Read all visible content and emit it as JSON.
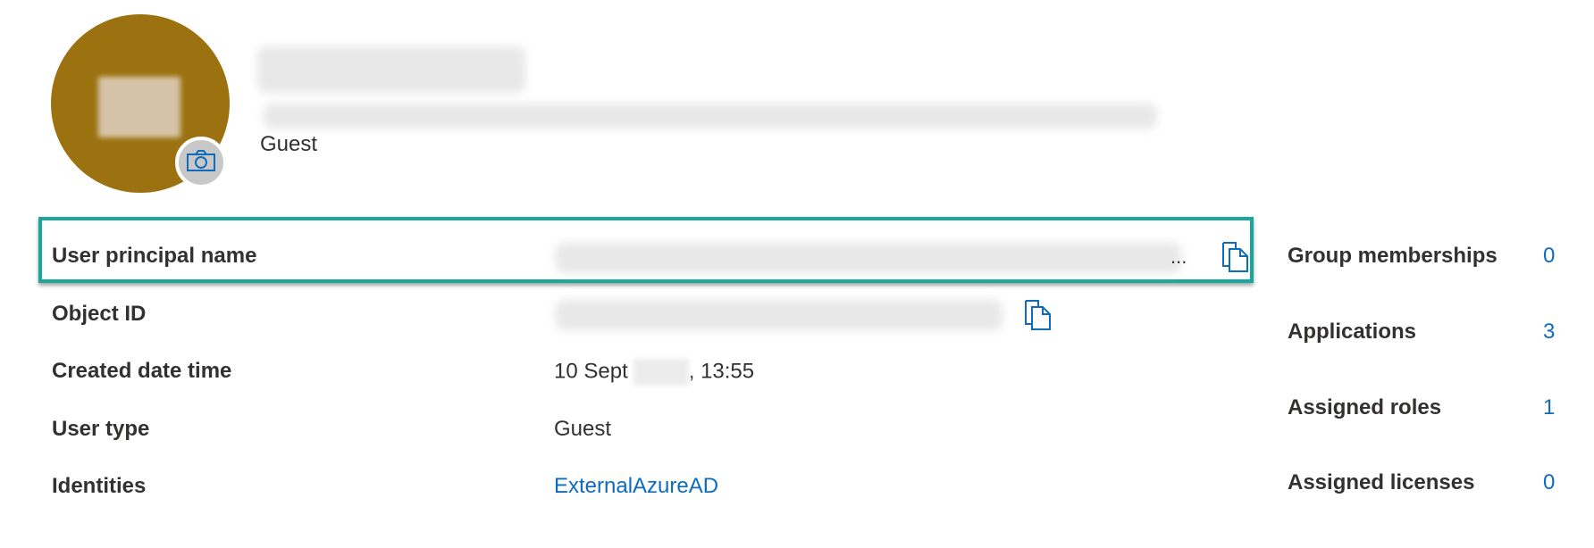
{
  "header": {
    "user_type": "Guest",
    "camera_icon": "camera-icon"
  },
  "properties": [
    {
      "label": "User principal name",
      "value": "",
      "ellipsis": "...",
      "copy_icon": "copy-icon"
    },
    {
      "label": "Object ID",
      "value": "",
      "copy_icon": "copy-icon"
    },
    {
      "label": "Created date time",
      "value_prefix": "10 Sept",
      "value_suffix": ", 13:55"
    },
    {
      "label": "User type",
      "value": "Guest"
    },
    {
      "label": "Identities",
      "value": "ExternalAzureAD"
    }
  ],
  "stats": [
    {
      "label": "Group memberships",
      "count": "0"
    },
    {
      "label": "Applications",
      "count": "3"
    },
    {
      "label": "Assigned roles",
      "count": "1"
    },
    {
      "label": "Assigned licenses",
      "count": "0"
    }
  ],
  "colors": {
    "avatar": "#9b720f",
    "link": "#0f6cbd",
    "highlight": "#18a79a"
  }
}
